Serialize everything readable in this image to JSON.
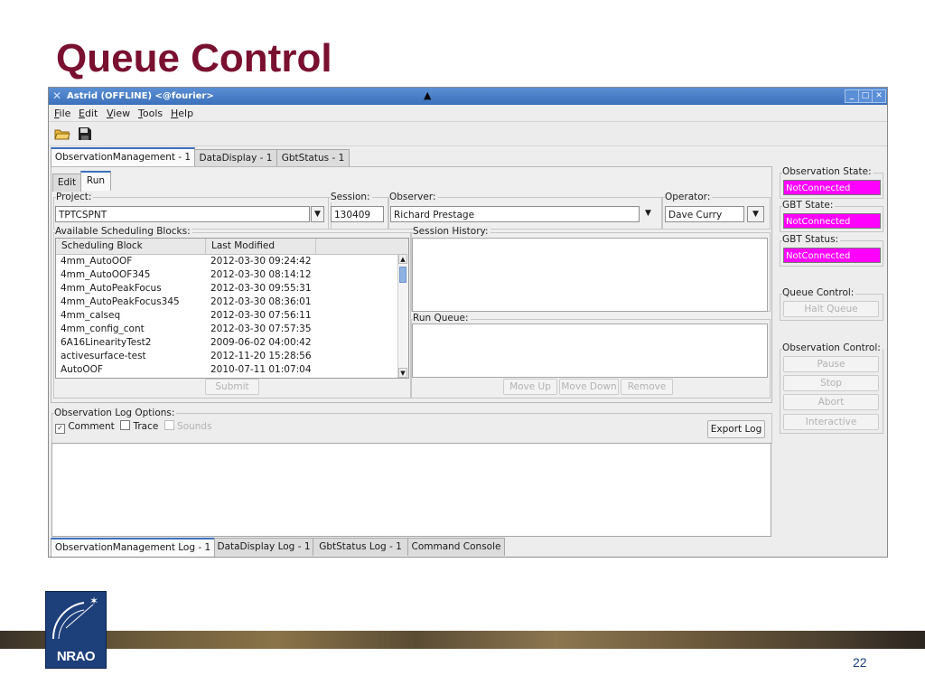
{
  "slide": {
    "title": "Queue Control",
    "page_number": "22",
    "logo_text": "NRAO"
  },
  "window": {
    "title": "Astrid (OFFLINE) <@fourier>"
  },
  "menu": [
    "File",
    "Edit",
    "View",
    "Tools",
    "Help"
  ],
  "toolbar": {
    "icons": [
      "open-folder-icon",
      "save-icon"
    ]
  },
  "main_tabs": [
    "ObservationManagement - 1",
    "DataDisplay - 1",
    "GbtStatus - 1"
  ],
  "sub_tabs": [
    "Edit",
    "Run"
  ],
  "project": {
    "label": "Project:",
    "value": "TPTCSPNT"
  },
  "session": {
    "label": "Session:",
    "value": "130409"
  },
  "observer": {
    "label": "Observer:",
    "value": "Richard Prestage"
  },
  "operator": {
    "label": "Operator:",
    "value": "Dave Curry"
  },
  "scheduling": {
    "label": "Available Scheduling Blocks:",
    "columns": [
      "Scheduling Block",
      "Last Modified"
    ],
    "rows": [
      [
        "4mm_AutoOOF",
        "2012-03-30 09:24:42"
      ],
      [
        "4mm_AutoOOF345",
        "2012-03-30 08:14:12"
      ],
      [
        "4mm_AutoPeakFocus",
        "2012-03-30 09:55:31"
      ],
      [
        "4mm_AutoPeakFocus345",
        "2012-03-30 08:36:01"
      ],
      [
        "4mm_calseq",
        "2012-03-30 07:56:11"
      ],
      [
        "4mm_config_cont",
        "2012-03-30 07:57:35"
      ],
      [
        "6A16LinearityTest2",
        "2009-06-02 04:00:42"
      ],
      [
        "activesurface-test",
        "2012-11-20 15:28:56"
      ],
      [
        "AutoOOF",
        "2010-07-11 01:07:04"
      ]
    ],
    "submit_label": "Submit"
  },
  "session_history": {
    "label": "Session History:"
  },
  "run_queue": {
    "label": "Run Queue:",
    "buttons": [
      "Move Up",
      "Move Down",
      "Remove"
    ]
  },
  "log_options": {
    "label": "Observation Log Options:",
    "comment": "Comment",
    "trace": "Trace",
    "sounds": "Sounds",
    "export_label": "Export Log"
  },
  "status": {
    "observation_state": {
      "label": "Observation State:",
      "value": "NotConnected"
    },
    "gbt_state": {
      "label": "GBT State:",
      "value": "NotConnected"
    },
    "gbt_status": {
      "label": "GBT Status:",
      "value": "NotConnected"
    },
    "color": "#ff00ff"
  },
  "queue_control": {
    "label": "Queue Control:",
    "halt": "Halt Queue"
  },
  "observation_control": {
    "label": "Observation Control:",
    "buttons": [
      "Pause",
      "Stop",
      "Abort",
      "Interactive"
    ]
  },
  "bottom_tabs": [
    "ObservationManagement Log - 1",
    "DataDisplay Log - 1",
    "GbtStatus Log - 1",
    "Command Console"
  ]
}
